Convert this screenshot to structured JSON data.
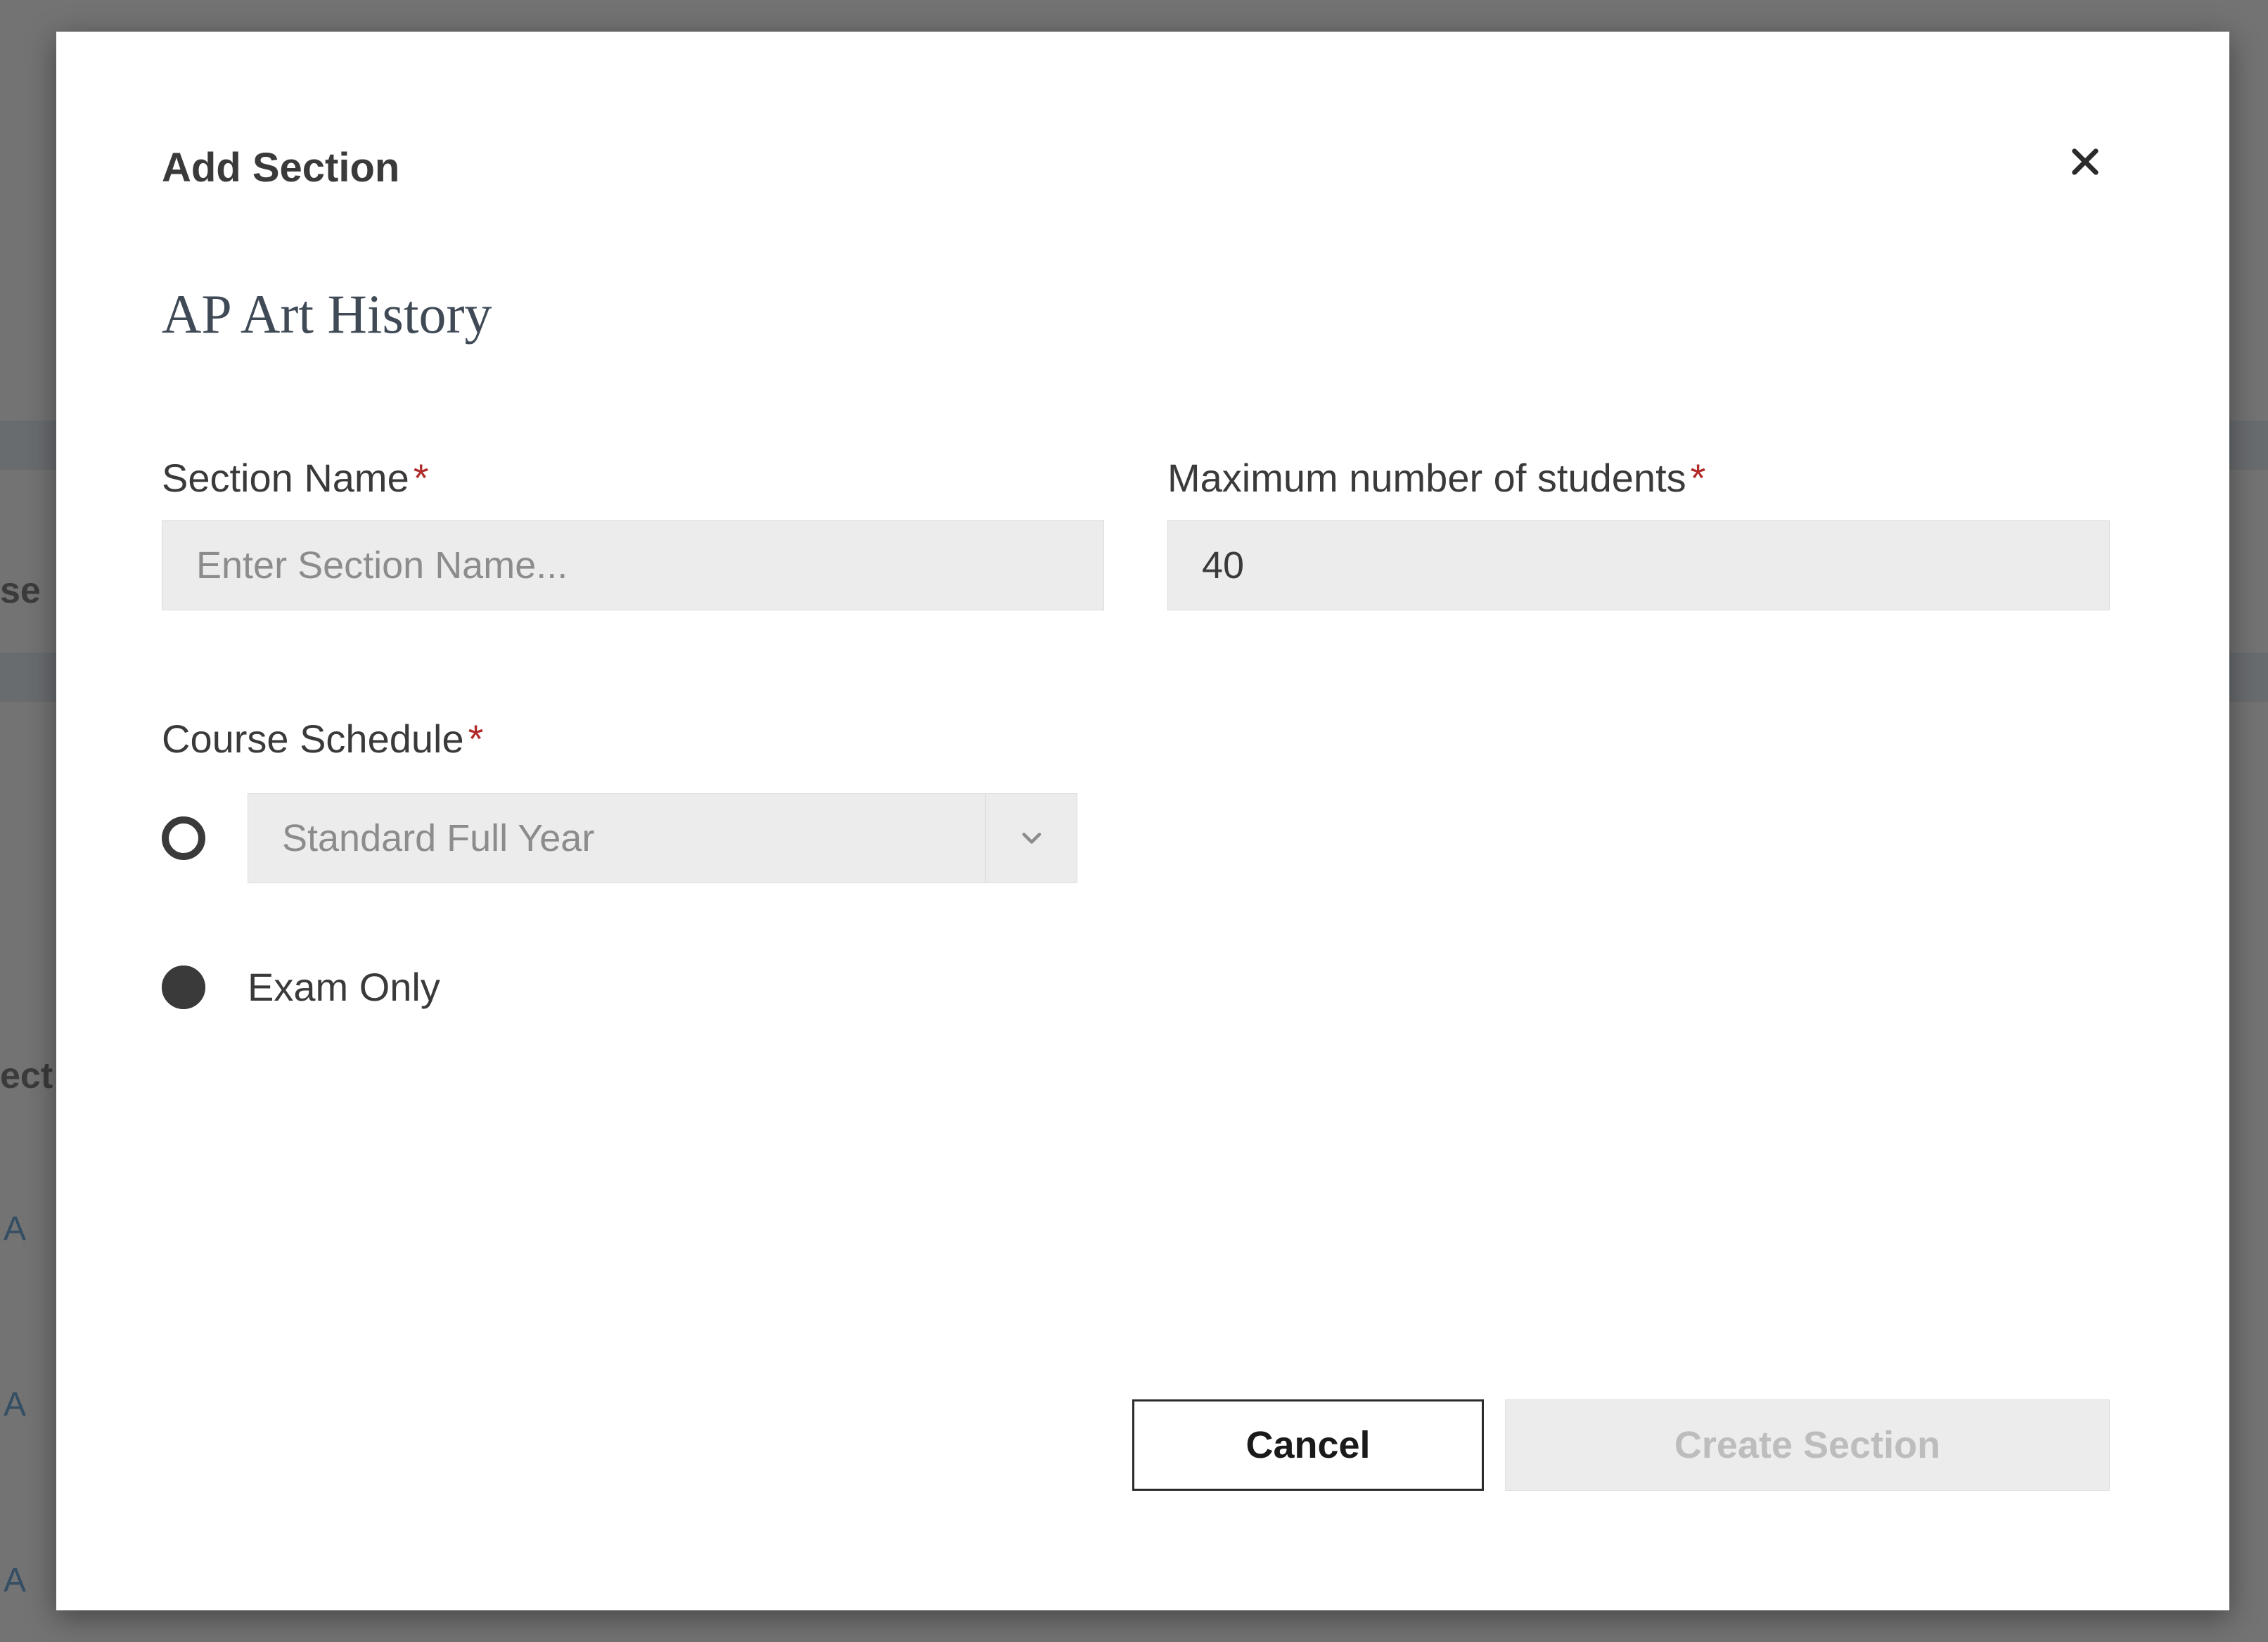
{
  "modal": {
    "title": "Add Section",
    "course_name": "AP Art History",
    "section_name": {
      "label": "Section Name",
      "required_marker": "*",
      "placeholder": "Enter Section Name...",
      "value": ""
    },
    "max_students": {
      "label": "Maximum number of students",
      "required_marker": "*",
      "value": "40"
    },
    "course_schedule": {
      "label": "Course Schedule",
      "required_marker": "*",
      "dropdown_value": "Standard Full Year",
      "exam_only_label": "Exam Only",
      "selected": "exam_only"
    },
    "buttons": {
      "cancel": "Cancel",
      "create": "Create Section"
    }
  },
  "background": {
    "frag1": "se",
    "frag2": "ect",
    "linkA": "A"
  }
}
